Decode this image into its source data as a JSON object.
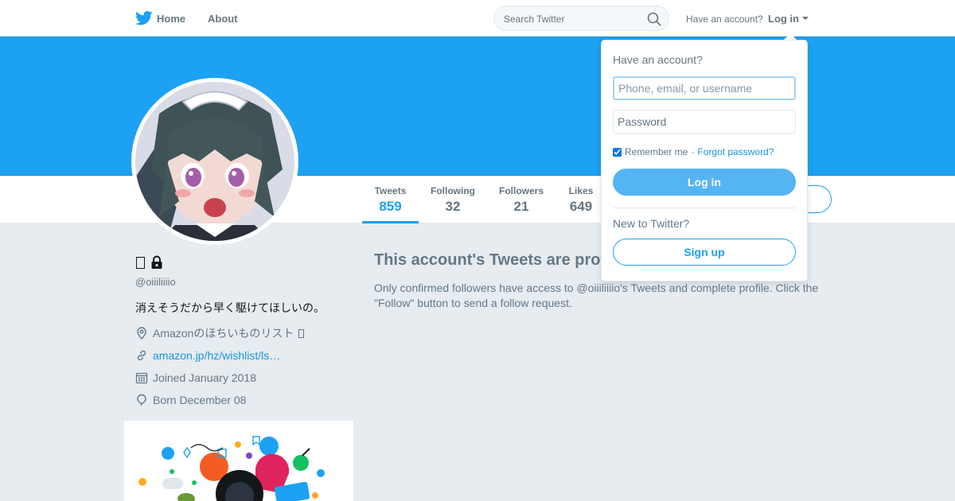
{
  "nav": {
    "home_label": "Home",
    "about_label": "About",
    "search_placeholder": "Search Twitter",
    "have_account_text": "Have an account?",
    "login_label": "Log in"
  },
  "profile": {
    "handle": "@oiiiliiiio",
    "bio": "消えそうだから早く駆けてほしいの。",
    "location": "Amazonのほちいものリスト",
    "url": "amazon.jp/hz/wishlist/ls…",
    "joined": "Joined January 2018",
    "born": "Born December 08"
  },
  "stats": [
    {
      "label": "Tweets",
      "value": "859"
    },
    {
      "label": "Following",
      "value": "32"
    },
    {
      "label": "Followers",
      "value": "21"
    },
    {
      "label": "Likes",
      "value": "649"
    }
  ],
  "protected": {
    "title": "This account's Tweets are protected.",
    "body": "Only confirmed followers have access to @oiiiliiiio's Tweets and complete profile. Click the \"Follow\" button to send a follow request."
  },
  "login_dropdown": {
    "heading": "Have an account?",
    "username_placeholder": "Phone, email, or username",
    "password_placeholder": "Password",
    "remember_label": "Remember me",
    "separator": "·",
    "forgot_label": "Forgot password?",
    "login_button": "Log in",
    "new_text": "New to Twitter?",
    "signup_button": "Sign up"
  },
  "colors": {
    "brand": "#1da1f2",
    "banner": "#1da1f2",
    "page_bg": "#e6ecf0",
    "link": "#1b95e0"
  }
}
